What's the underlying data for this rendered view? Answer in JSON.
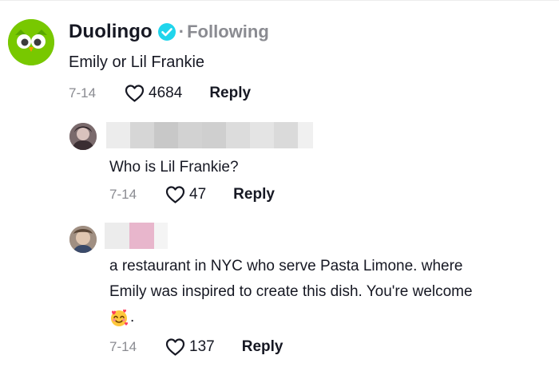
{
  "comment": {
    "author": "Duolingo",
    "follow_status": "Following",
    "separator": "·",
    "text": "Emily or Lil Frankie",
    "date": "7-14",
    "likes": "4684",
    "reply_label": "Reply"
  },
  "replies": [
    {
      "text": "Who is Lil Frankie?",
      "date": "7-14",
      "likes": "47",
      "reply_label": "Reply"
    },
    {
      "text_line1": "a restaurant in NYC who serve Pasta Limone. where",
      "text_line2": "Emily was inspired to create this dish. You're welcome",
      "text_end": ".",
      "emoji": "smiling-face-with-hearts-emoji",
      "date": "7-14",
      "likes": "137",
      "reply_label": "Reply"
    }
  ],
  "colors": {
    "duolingo_green": "#78c800",
    "verified_blue": "#20d5ec",
    "muted_text": "#8a8b91"
  }
}
